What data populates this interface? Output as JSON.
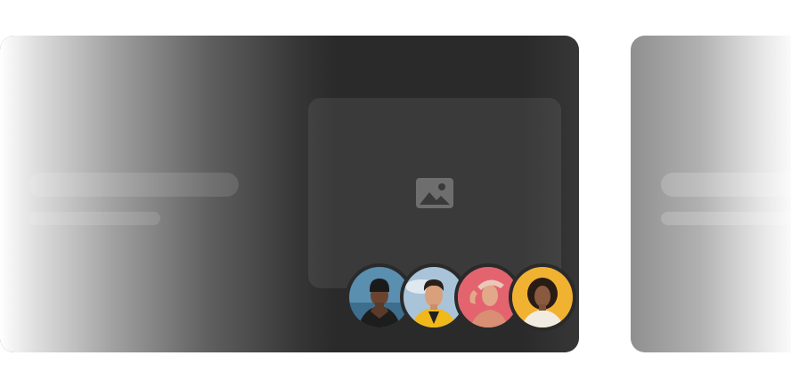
{
  "cards": [
    {
      "state": "active",
      "media_icon": "image-placeholder-icon",
      "avatars": [
        {
          "name": "avatar-man-beanie",
          "bg": "#5a8fb0"
        },
        {
          "name": "avatar-man-yellow-jacket",
          "bg": "#9ebbd2"
        },
        {
          "name": "avatar-woman-red-background",
          "bg": "#e3646e"
        },
        {
          "name": "avatar-woman-yellow-background",
          "bg": "#f1b232"
        }
      ]
    },
    {
      "state": "inactive"
    }
  ],
  "colors": {
    "card_dark": "#2a2a2a",
    "media_box": "#3a3a3a",
    "side_card": "#8f8f8f"
  }
}
